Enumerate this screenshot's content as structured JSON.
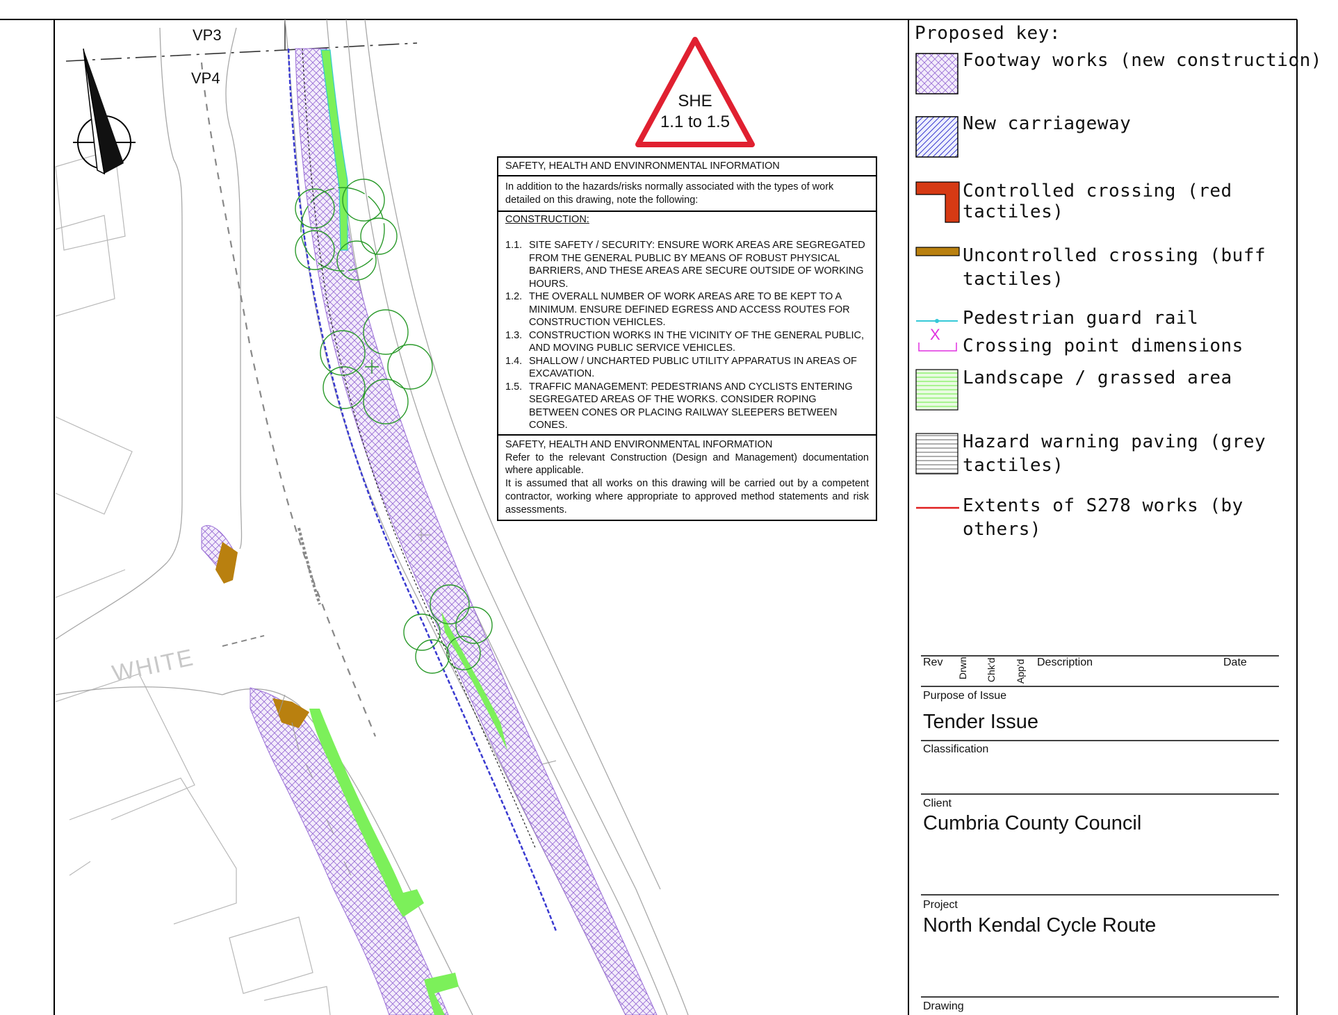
{
  "map": {
    "viewpoints": [
      "VP3",
      "VP4"
    ],
    "street_name": "WHITE",
    "she_triangle": {
      "line1": "SHE",
      "line2": "1.1 to 1.5"
    }
  },
  "she_info": {
    "heading": "SAFETY, HEALTH AND ENVINRONMENTAL INFORMATION",
    "intro": "In addition to the hazards/risks normally associated with the types of work detailed on this drawing, note the following:",
    "construction_title": "CONSTRUCTION:",
    "items": [
      {
        "num": "1.1.",
        "text": "SITE SAFETY / SECURITY: ENSURE WORK AREAS ARE SEGREGATED FROM THE GENERAL PUBLIC BY MEANS OF ROBUST PHYSICAL BARRIERS, AND THESE AREAS ARE SECURE OUTSIDE OF WORKING HOURS."
      },
      {
        "num": "1.2.",
        "text": "THE OVERALL NUMBER OF WORK AREAS ARE TO BE KEPT TO A MINIMUM. ENSURE DEFINED EGRESS AND ACCESS ROUTES FOR CONSTRUCTION VEHICLES."
      },
      {
        "num": "1.3.",
        "text": "CONSTRUCTION WORKS IN THE VICINITY OF THE GENERAL PUBLIC, AND MOVING PUBLIC SERVICE VEHICLES."
      },
      {
        "num": "1.4.",
        "text": "SHALLOW / UNCHARTED PUBLIC UTILITY APPARATUS IN AREAS OF EXCAVATION."
      },
      {
        "num": "1.5.",
        "text": "TRAFFIC MANAGEMENT: PEDESTRIANS AND CYCLISTS ENTERING SEGREGATED AREAS OF THE WORKS. CONSIDER ROPING BETWEEN CONES OR PLACING RAILWAY SLEEPERS BETWEEN CONES."
      }
    ],
    "footer_heading": "SAFETY, HEALTH AND ENVIRONMENTAL INFORMATION",
    "footer_para1": "Refer to the relevant Construction (Design and Management) documentation where applicable.",
    "footer_para2": "It is assumed that all works on this drawing will be carried out by a competent contractor, working where appropriate to approved method statements and risk assessments."
  },
  "key": {
    "title": "Proposed key:",
    "items": [
      {
        "line1": "Footway works (new construction)",
        "line2": ""
      },
      {
        "line1": "New carriageway",
        "line2": ""
      },
      {
        "line1": "Controlled crossing (red tactiles)",
        "line2": ""
      },
      {
        "line1": "Uncontrolled crossing (buff",
        "line2": "tactiles)"
      },
      {
        "line1": "Pedestrian guard rail",
        "line2": ""
      },
      {
        "line1": "Crossing point dimensions",
        "line2": "",
        "symbol": "X"
      },
      {
        "line1": "Landscape / grassed area",
        "line2": ""
      },
      {
        "line1": "Hazard warning paving (grey",
        "line2": "tactiles)"
      },
      {
        "line1": "Extents of S278 works (by",
        "line2": "others)"
      }
    ]
  },
  "title_block": {
    "rev_table": {
      "rev": "Rev",
      "drwn": "Drwn",
      "chkd": "Chk'd",
      "appd": "App'd",
      "description": "Description",
      "date": "Date"
    },
    "purpose_label": "Purpose of Issue",
    "purpose_value": "Tender Issue",
    "classification_label": "Classification",
    "client_label": "Client",
    "client_value": "Cumbria County Council",
    "project_label": "Project",
    "project_value": "North Kendal Cycle Route",
    "drawing_label": "Drawing"
  },
  "colors": {
    "footway": "#9a6fd6",
    "carriageway": "#3a3ad0",
    "controlled_crossing": "#d63a14",
    "uncontrolled_crossing": "#b9800f",
    "guard_rail": "#36c9d8",
    "dimension": "#e030e0",
    "landscape": "#7cf05a",
    "tree": "#2a9a2a",
    "s278": "#e02020"
  }
}
